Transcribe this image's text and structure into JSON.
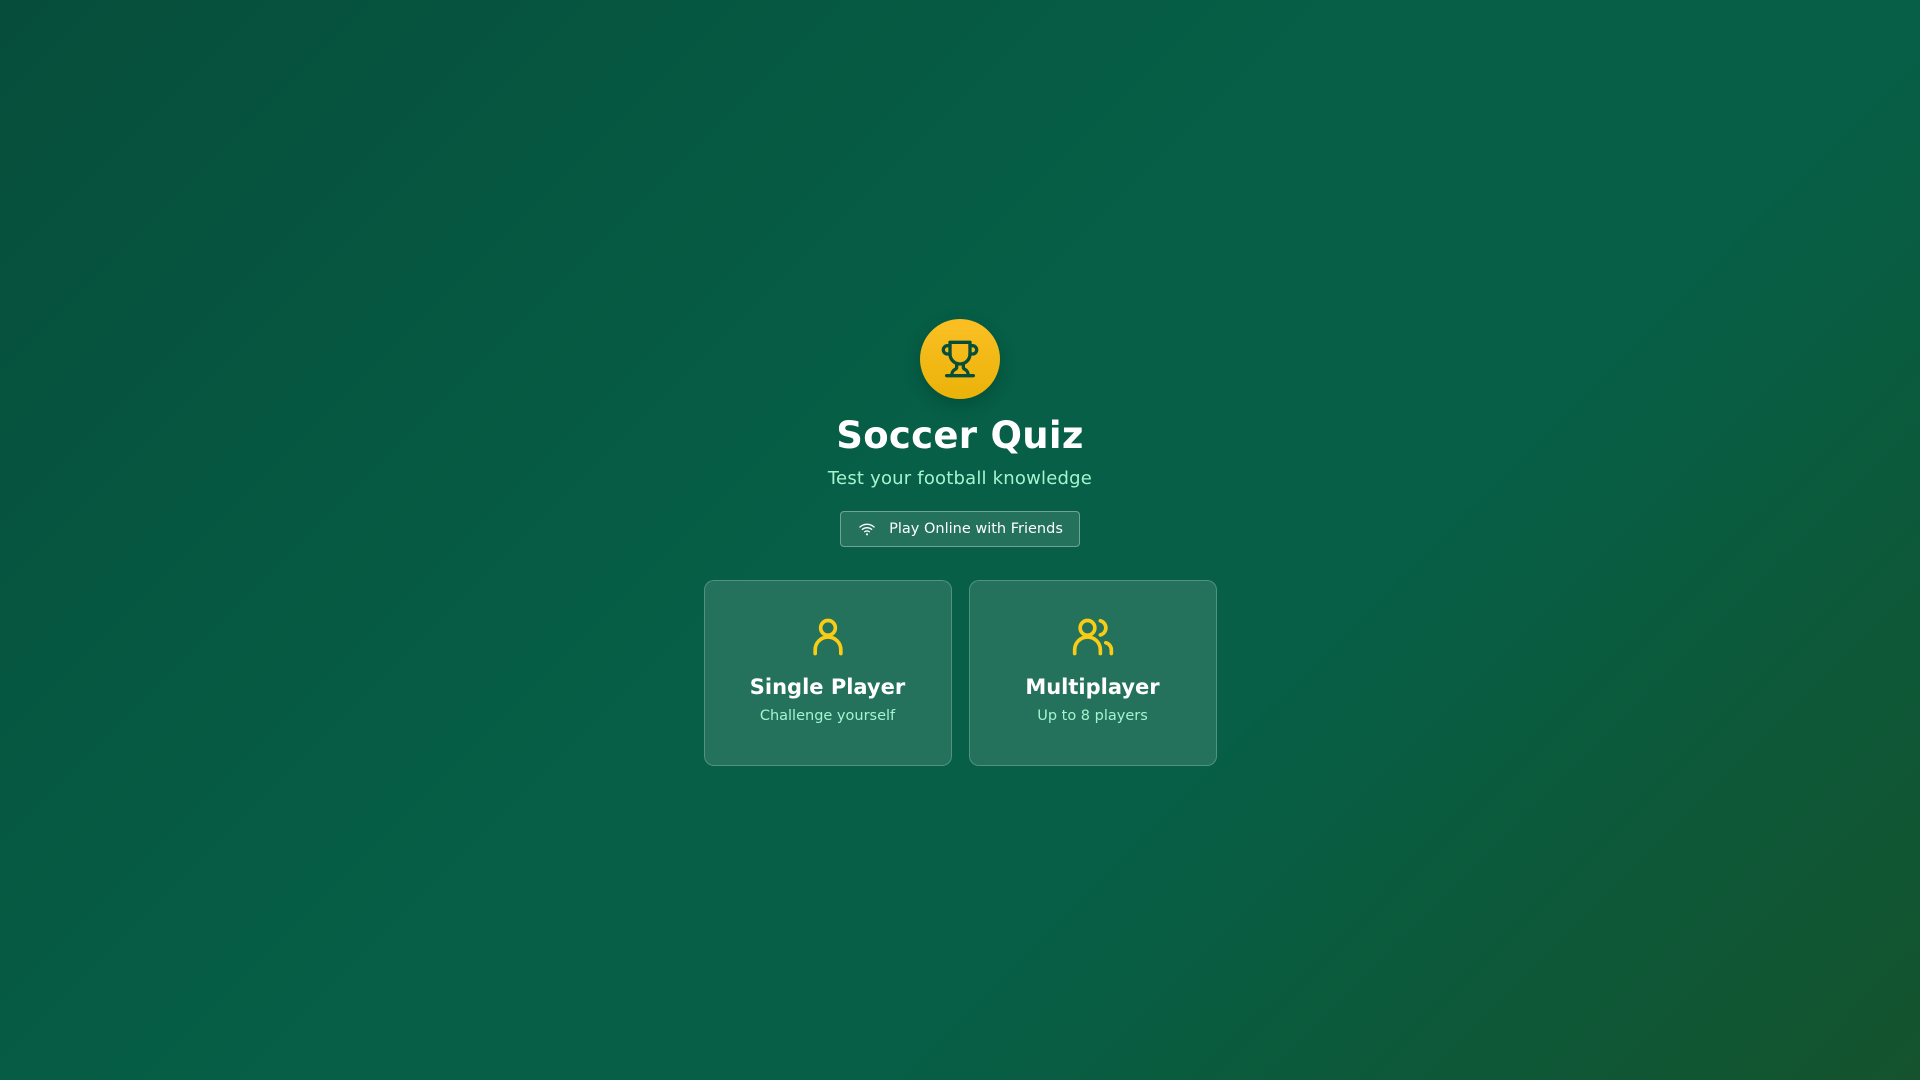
{
  "app": {
    "title": "Soccer Quiz",
    "subtitle": "Test your football knowledge"
  },
  "online": {
    "label": "Play Online with Friends",
    "icon": "wifi-icon"
  },
  "logo": {
    "icon": "trophy-icon"
  },
  "modes": [
    {
      "title": "Single Player",
      "subtitle": "Challenge yourself",
      "icon": "user-icon"
    },
    {
      "title": "Multiplayer",
      "subtitle": "Up to 8 players",
      "icon": "users-icon"
    }
  ],
  "colors": {
    "accent": "#facc15",
    "background": "#065f46",
    "subtitle_text": "#a7f3d0",
    "icon_dark": "#064e3b"
  }
}
